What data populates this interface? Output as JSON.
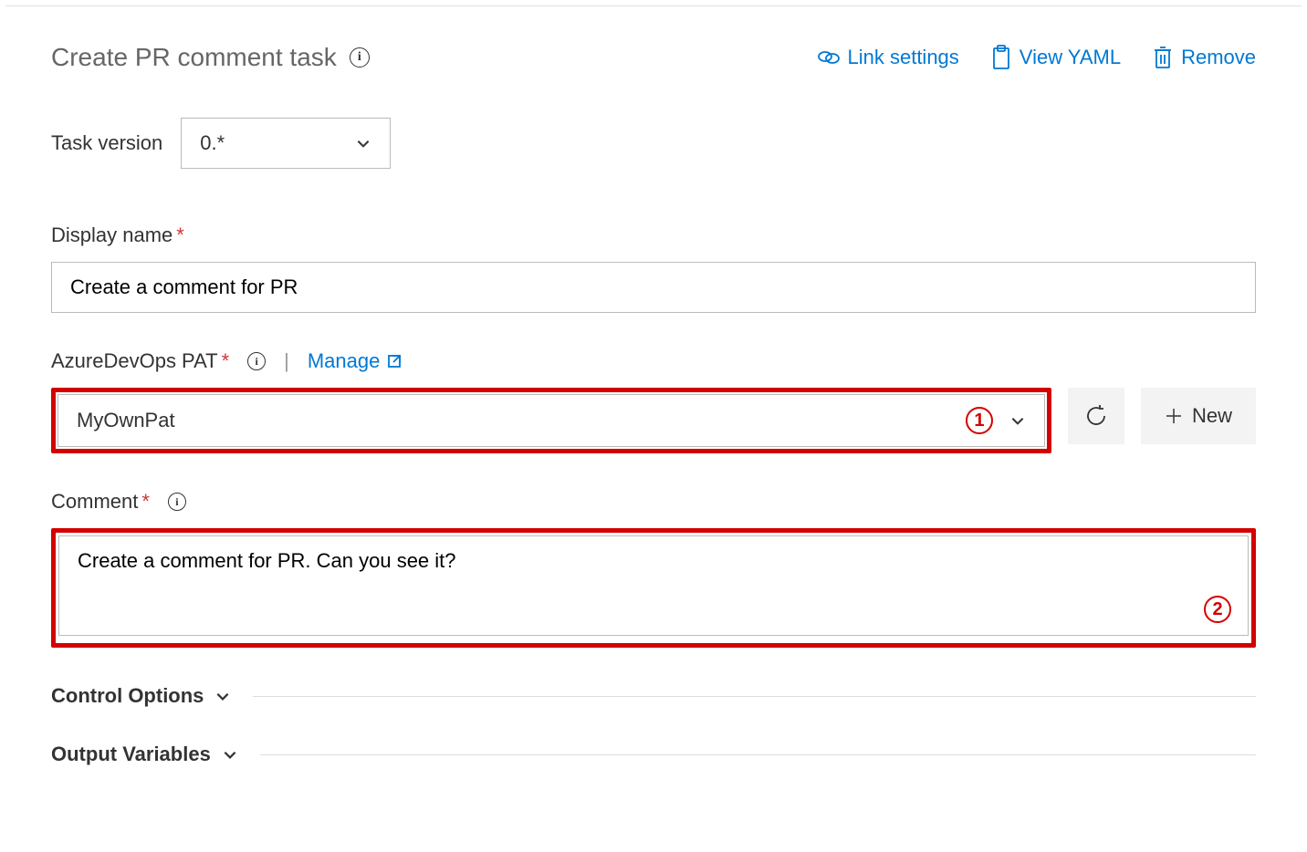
{
  "header": {
    "title": "Create PR comment task",
    "actions": {
      "link_settings": "Link settings",
      "view_yaml": "View YAML",
      "remove": "Remove"
    }
  },
  "task_version": {
    "label": "Task version",
    "value": "0.*"
  },
  "display_name": {
    "label": "Display name",
    "value": "Create a comment for PR"
  },
  "pat": {
    "label": "AzureDevOps PAT",
    "manage_label": "Manage",
    "value": "MyOwnPat",
    "new_label": "New"
  },
  "comment": {
    "label": "Comment",
    "value": "Create a comment for PR. Can you see it?"
  },
  "sections": {
    "control_options": "Control Options",
    "output_variables": "Output Variables"
  },
  "annotations": {
    "one": "1",
    "two": "2"
  }
}
